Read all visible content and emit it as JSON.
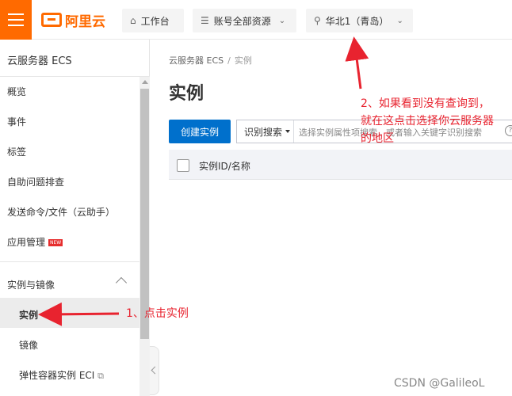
{
  "header": {
    "logo_text": "阿里云",
    "workbench_label": "工作台",
    "resources_label": "账号全部资源",
    "region_label": "华北1（青岛）"
  },
  "sidebar": {
    "title": "云服务器 ECS",
    "items": [
      {
        "label": "概览"
      },
      {
        "label": "事件"
      },
      {
        "label": "标签"
      },
      {
        "label": "自助问题排查"
      },
      {
        "label": "发送命令/文件（云助手）"
      },
      {
        "label": "应用管理",
        "badge": "NEW"
      }
    ],
    "group_label": "实例与镜像",
    "sub_items": [
      {
        "label": "实例"
      },
      {
        "label": "镜像"
      },
      {
        "label": "弹性容器实例 ECI"
      }
    ]
  },
  "main": {
    "breadcrumb": [
      "云服务器 ECS",
      "实例"
    ],
    "title": "实例",
    "create_button": "创建实例",
    "search_select": "识别搜索",
    "search_placeholder": "选择实例属性项搜索，或者输入关键字识别搜索",
    "table_header": "实例ID/名称"
  },
  "annotations": {
    "step1": "1、点击实例",
    "step2_line1": "2、如果看到没有查询到，",
    "step2_line2": "就在这点击选择你云服务器",
    "step2_line3": "的地区"
  },
  "watermark": "CSDN @GalileoL",
  "colors": {
    "brand": "#ff6a00",
    "primary": "#0070cc",
    "annotation": "#e8232f"
  }
}
